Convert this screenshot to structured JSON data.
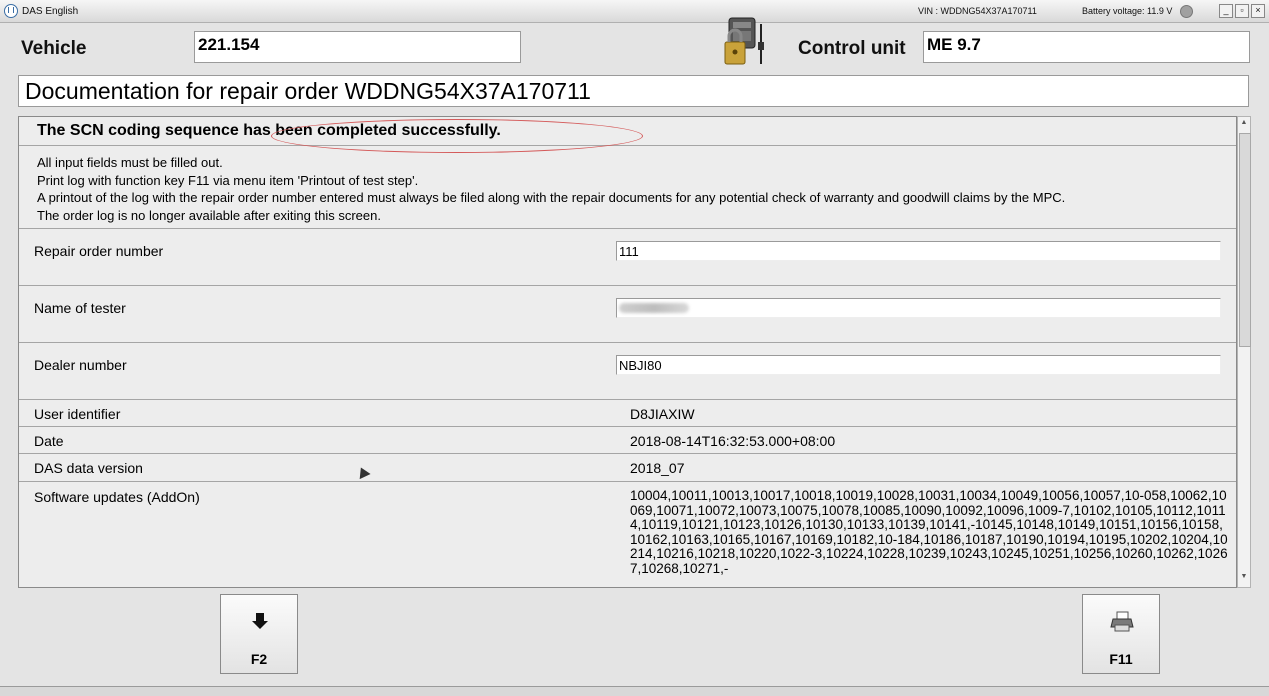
{
  "window": {
    "title": "DAS English",
    "vin": "VIN : WDDNG54X37A170711",
    "battery": "Battery voltage: 11.9 V"
  },
  "header": {
    "vehicle_label": "Vehicle",
    "vehicle_value": "221.154",
    "control_unit_label": "Control unit",
    "control_unit_value": "ME 9.7",
    "doc_title": "Documentation for repair order WDDNG54X37A170711"
  },
  "panel": {
    "status": "The SCN coding sequence has been completed successfully.",
    "info_lines": [
      "All input fields must be filled out.",
      "Print log with function key F11 via menu item 'Printout of test step'.",
      "A printout of the log with the repair order number entered must always be filed along with the repair documents for any potential check of warranty and goodwill claims by the MPC.",
      "The order log is no longer available after exiting this screen."
    ],
    "fields": {
      "repair_order_label": "Repair order number",
      "repair_order_value": "111",
      "tester_label": "Name of tester",
      "dealer_label": "Dealer number",
      "dealer_value": "NBJI80",
      "user_label": "User identifier",
      "user_value": "D8JIAXIW",
      "date_label": "Date",
      "date_value": "2018-08-14T16:32:53.000+08:00",
      "das_label": "DAS data version",
      "das_value": "2018_07",
      "addon_label": "Software updates (AddOn)",
      "addon_value": "10004,10011,10013,10017,10018,10019,10028,10031,10034,10049,10056,10057,10-058,10062,10069,10071,10072,10073,10075,10078,10085,10090,10092,10096,1009-7,10102,10105,10112,10114,10119,10121,10123,10126,10130,10133,10139,10141,-10145,10148,10149,10151,10156,10158,10162,10163,10165,10167,10169,10182,10-184,10186,10187,10190,10194,10195,10202,10204,10214,10216,10218,10220,1022-3,10224,10228,10239,10243,10245,10251,10256,10260,10262,10267,10268,10271,-"
    }
  },
  "buttons": {
    "f2": "F2",
    "f11": "F11"
  },
  "icons": {
    "f2": "down-arrow-icon",
    "f11": "printer-icon",
    "control_unit": "locked-ecu-icon"
  }
}
